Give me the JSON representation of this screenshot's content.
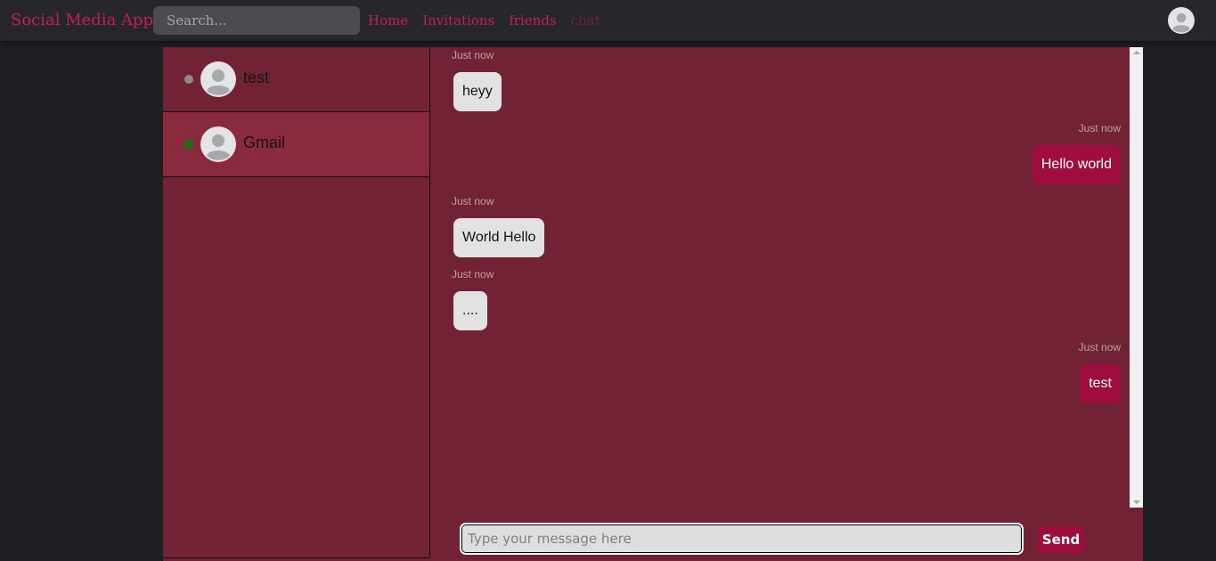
{
  "app": {
    "title": "Social Media App"
  },
  "search": {
    "placeholder": "Search..."
  },
  "nav": {
    "links": [
      {
        "label": "Home"
      },
      {
        "label": "Invitations"
      },
      {
        "label": "friends"
      },
      {
        "label": "chat",
        "active": true
      }
    ],
    "avatar_icon": "user-avatar-icon"
  },
  "contacts": [
    {
      "name": "test",
      "status": "offline",
      "status_color": "#8c8c8c",
      "selected": false
    },
    {
      "name": "Gmail",
      "status": "online",
      "status_color": "#0f7a0f",
      "selected": true
    }
  ],
  "messages": [
    {
      "side": "received",
      "time": "Just now",
      "text": "heyy"
    },
    {
      "side": "sent",
      "time": "Just now",
      "text": "Hello world"
    },
    {
      "side": "received",
      "time": "Just now",
      "text": "World Hello"
    },
    {
      "side": "received",
      "time": "Just now",
      "text": "...."
    },
    {
      "side": "sent",
      "time": "Just now",
      "text": "test"
    }
  ],
  "composer": {
    "placeholder": "Type your message here",
    "value": "",
    "send_label": "Send"
  },
  "colors": {
    "accent": "#c0214e",
    "panel": "#712234",
    "selected_contact": "#892a3f",
    "sent_bubble": "#9e0d3e",
    "received_bubble": "#e2e2e2"
  }
}
